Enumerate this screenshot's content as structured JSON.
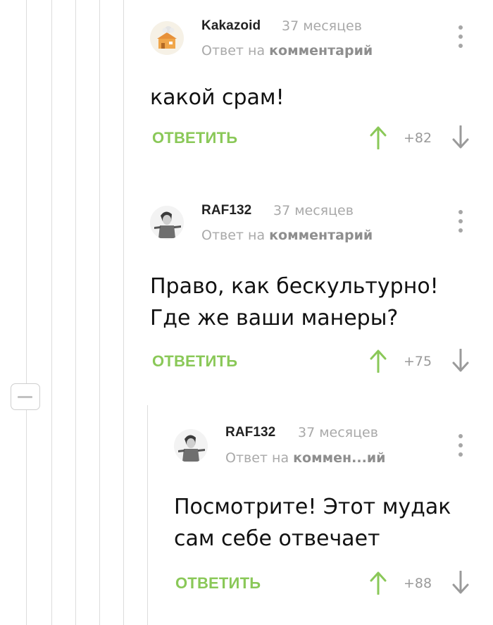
{
  "comments": [
    {
      "author": "Kakazoid",
      "time": "37 месяцев",
      "reply_prefix": "Ответ на",
      "reply_target": "комментарий",
      "text_lines": [
        "какой срам!"
      ],
      "reply_label": "ОТВЕТИТЬ",
      "rating": "+82"
    },
    {
      "author": "RAF132",
      "time": "37 месяцев",
      "reply_prefix": "Ответ на",
      "reply_target": "комментарий",
      "text_lines": [
        "Право, как бескультурно!",
        "Где же ваши манеры?"
      ],
      "reply_label": "ОТВЕТИТЬ",
      "rating": "+75"
    },
    {
      "author": "RAF132",
      "time": "37 месяцев",
      "reply_prefix": "Ответ на",
      "reply_target": "коммен...ий",
      "text_lines": [
        "Посмотрите! Этот мудак",
        "сам себе отвечает"
      ],
      "reply_label": "ОТВЕТИТЬ",
      "rating": "+88"
    }
  ],
  "icons": {
    "upvote": "arrow-up-icon",
    "downvote": "arrow-down-icon",
    "menu": "kebab-menu-icon",
    "collapse": "minus-icon"
  },
  "colors": {
    "accent": "#8ac858",
    "muted": "#a9a9a9",
    "thread_line": "#dcdcdc"
  }
}
